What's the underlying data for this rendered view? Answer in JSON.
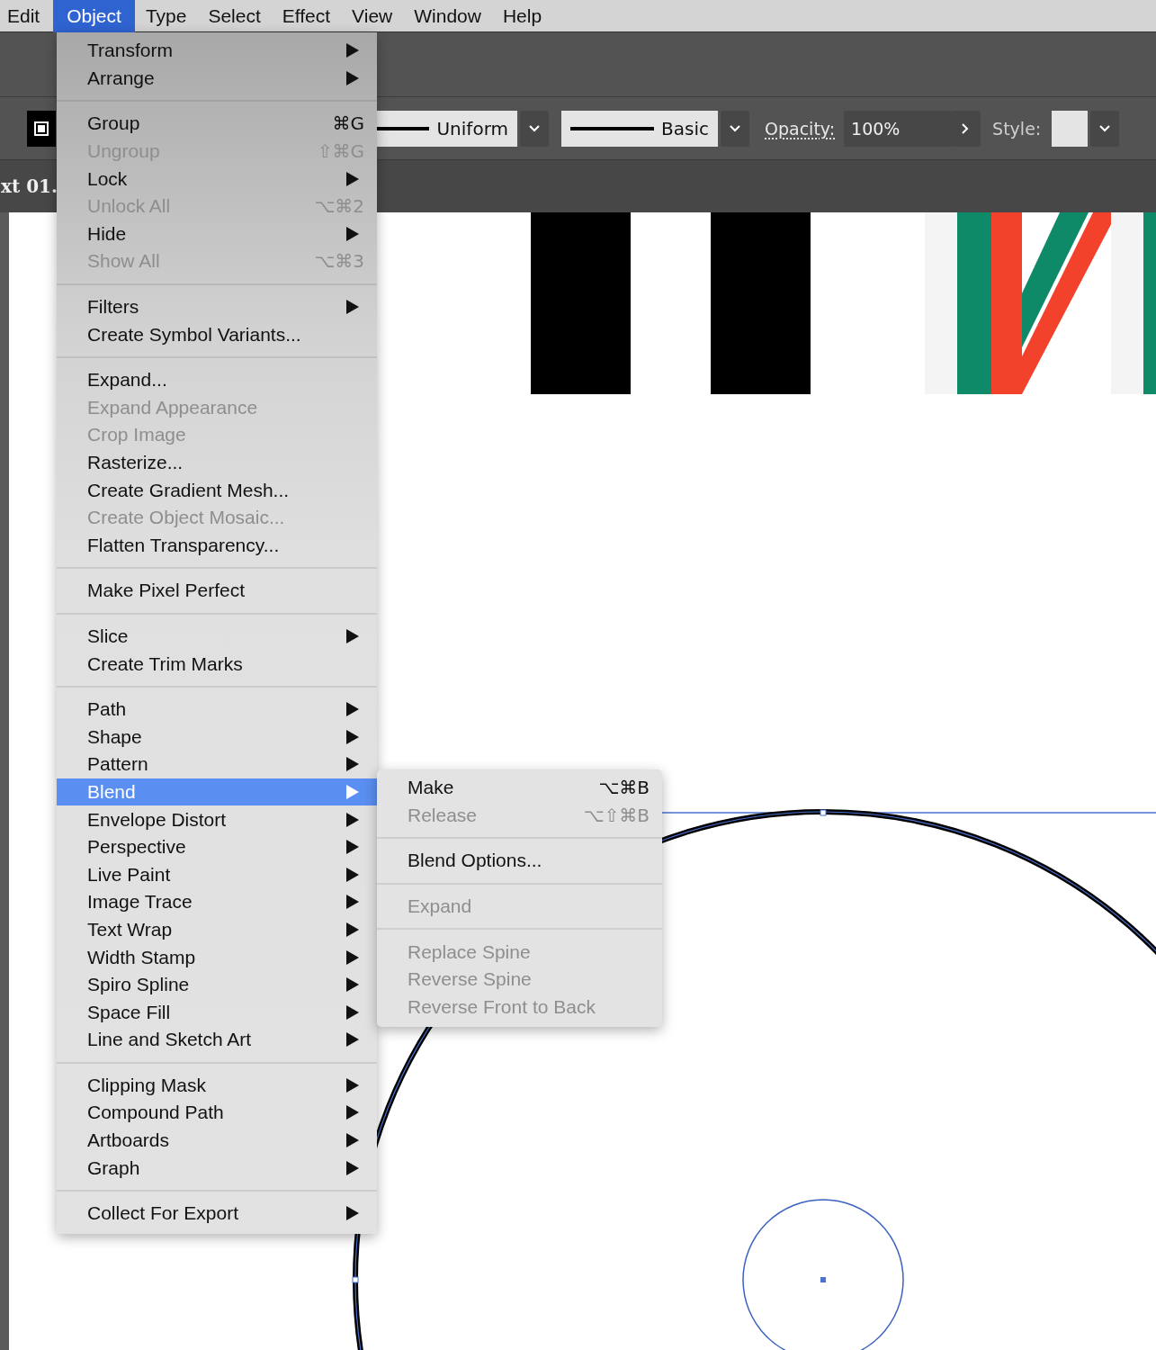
{
  "menubar": [
    {
      "label": "Edit",
      "selected": false
    },
    {
      "label": "Object",
      "selected": true
    },
    {
      "label": "Type",
      "selected": false
    },
    {
      "label": "Select",
      "selected": false
    },
    {
      "label": "Effect",
      "selected": false
    },
    {
      "label": "View",
      "selected": false
    },
    {
      "label": "Window",
      "selected": false
    },
    {
      "label": "Help",
      "selected": false
    }
  ],
  "toolbar": {
    "stroke_profile": "Uniform",
    "brush": "Basic",
    "opacity_label": "Opacity:",
    "opacity_value": "100%",
    "style_label": "Style:"
  },
  "document_tab": "xt 01.",
  "object_menu": {
    "sections": [
      [
        {
          "label": "Transform",
          "submenu": true,
          "disabled": false,
          "selected": false
        },
        {
          "label": "Arrange",
          "submenu": true,
          "disabled": false,
          "selected": false
        }
      ],
      [
        {
          "label": "Group",
          "shortcut": "⌘G",
          "submenu": false,
          "disabled": false,
          "selected": false
        },
        {
          "label": "Ungroup",
          "shortcut": "⇧⌘G",
          "submenu": false,
          "disabled": true,
          "selected": false
        },
        {
          "label": "Lock",
          "submenu": true,
          "disabled": false,
          "selected": false
        },
        {
          "label": "Unlock All",
          "shortcut": "⌥⌘2",
          "submenu": false,
          "disabled": true,
          "selected": false
        },
        {
          "label": "Hide",
          "submenu": true,
          "disabled": false,
          "selected": false
        },
        {
          "label": "Show All",
          "shortcut": "⌥⌘3",
          "submenu": false,
          "disabled": true,
          "selected": false
        }
      ],
      [
        {
          "label": "Filters",
          "submenu": true,
          "disabled": false,
          "selected": false
        },
        {
          "label": "Create Symbol Variants...",
          "submenu": false,
          "disabled": false,
          "selected": false
        }
      ],
      [
        {
          "label": "Expand...",
          "submenu": false,
          "disabled": false,
          "selected": false
        },
        {
          "label": "Expand Appearance",
          "submenu": false,
          "disabled": true,
          "selected": false
        },
        {
          "label": "Crop Image",
          "submenu": false,
          "disabled": true,
          "selected": false
        },
        {
          "label": "Rasterize...",
          "submenu": false,
          "disabled": false,
          "selected": false
        },
        {
          "label": "Create Gradient Mesh...",
          "submenu": false,
          "disabled": false,
          "selected": false
        },
        {
          "label": "Create Object Mosaic...",
          "submenu": false,
          "disabled": true,
          "selected": false
        },
        {
          "label": "Flatten Transparency...",
          "submenu": false,
          "disabled": false,
          "selected": false
        }
      ],
      [
        {
          "label": "Make Pixel Perfect",
          "submenu": false,
          "disabled": false,
          "selected": false
        }
      ],
      [
        {
          "label": "Slice",
          "submenu": true,
          "disabled": false,
          "selected": false
        },
        {
          "label": "Create Trim Marks",
          "submenu": false,
          "disabled": false,
          "selected": false
        }
      ],
      [
        {
          "label": "Path",
          "submenu": true,
          "disabled": false,
          "selected": false
        },
        {
          "label": "Shape",
          "submenu": true,
          "disabled": false,
          "selected": false
        },
        {
          "label": "Pattern",
          "submenu": true,
          "disabled": false,
          "selected": false
        },
        {
          "label": "Blend",
          "submenu": true,
          "disabled": false,
          "selected": true
        },
        {
          "label": "Envelope Distort",
          "submenu": true,
          "disabled": false,
          "selected": false
        },
        {
          "label": "Perspective",
          "submenu": true,
          "disabled": false,
          "selected": false
        },
        {
          "label": "Live Paint",
          "submenu": true,
          "disabled": false,
          "selected": false
        },
        {
          "label": "Image Trace",
          "submenu": true,
          "disabled": false,
          "selected": false
        },
        {
          "label": "Text Wrap",
          "submenu": true,
          "disabled": false,
          "selected": false
        },
        {
          "label": "Width Stamp",
          "submenu": true,
          "disabled": false,
          "selected": false
        },
        {
          "label": "Spiro Spline",
          "submenu": true,
          "disabled": false,
          "selected": false
        },
        {
          "label": "Space Fill",
          "submenu": true,
          "disabled": false,
          "selected": false
        },
        {
          "label": "Line and Sketch Art",
          "submenu": true,
          "disabled": false,
          "selected": false
        }
      ],
      [
        {
          "label": "Clipping Mask",
          "submenu": true,
          "disabled": false,
          "selected": false
        },
        {
          "label": "Compound Path",
          "submenu": true,
          "disabled": false,
          "selected": false
        },
        {
          "label": "Artboards",
          "submenu": true,
          "disabled": false,
          "selected": false
        },
        {
          "label": "Graph",
          "submenu": true,
          "disabled": false,
          "selected": false
        }
      ],
      [
        {
          "label": "Collect For Export",
          "submenu": true,
          "disabled": false,
          "selected": false
        }
      ]
    ]
  },
  "blend_submenu": {
    "sections": [
      [
        {
          "label": "Make",
          "shortcut": "⌥⌘B",
          "submenu": false,
          "disabled": false,
          "selected": false
        },
        {
          "label": "Release",
          "shortcut": "⌥⇧⌘B",
          "submenu": false,
          "disabled": true,
          "selected": false
        }
      ],
      [
        {
          "label": "Blend Options...",
          "submenu": false,
          "disabled": false,
          "selected": false
        }
      ],
      [
        {
          "label": "Expand",
          "submenu": false,
          "disabled": true,
          "selected": false
        }
      ],
      [
        {
          "label": "Replace Spine",
          "submenu": false,
          "disabled": true,
          "selected": false
        },
        {
          "label": "Reverse Spine",
          "submenu": false,
          "disabled": true,
          "selected": false
        },
        {
          "label": "Reverse Front to Back",
          "submenu": false,
          "disabled": true,
          "selected": false
        }
      ]
    ]
  }
}
